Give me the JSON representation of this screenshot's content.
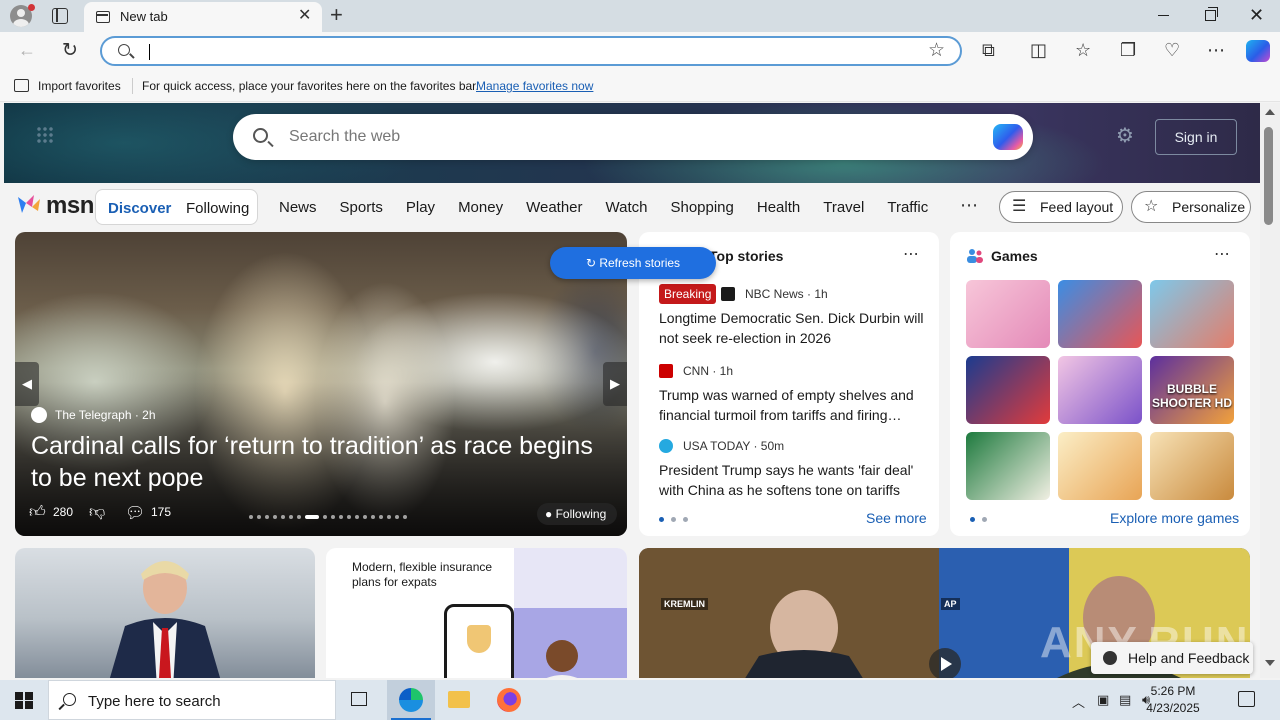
{
  "browser": {
    "tab_title": "New tab",
    "address_value": "",
    "favbar": {
      "import_label": "Import favorites",
      "message": "For quick access, place your favorites here on the favorites bar.",
      "link": "Manage favorites now"
    }
  },
  "msn": {
    "search_placeholder": "Search the web",
    "sign_in": "Sign in",
    "logo": "msn",
    "feed_tabs": {
      "discover": "Discover",
      "following": "Following"
    },
    "nav": [
      "News",
      "Sports",
      "Play",
      "Money",
      "Weather",
      "Watch",
      "Shopping",
      "Health",
      "Travel",
      "Traffic"
    ],
    "feed_layout": "Feed layout",
    "personalize": "Personalize",
    "refresh": "Refresh stories",
    "hero": {
      "source": "The Telegraph",
      "age": "2h",
      "title": "Cardinal calls for ‘return to tradition’ as race begins to be next pope",
      "likes": "280",
      "comments": "175",
      "following": "Following",
      "slide_active": 7,
      "slide_count": 19
    },
    "stories": {
      "title": "Top stories",
      "items": [
        {
          "badge": "Breaking",
          "source": "NBC News · 1h",
          "logo_color": "#1a1a1a",
          "headline": "Longtime Democratic Sen. Dick Durbin will not seek re-election in 2026"
        },
        {
          "source": "CNN · 1h",
          "logo_color": "#cc0000",
          "headline": "Trump was warned of empty shelves and financial turmoil from tariffs and firing…"
        },
        {
          "source": "USA TODAY · 50m",
          "logo_color": "#25a9e0",
          "headline": "President Trump says he wants 'fair deal' with China as he softens tone on tariffs"
        }
      ],
      "see_more": "See more"
    },
    "games": {
      "title": "Games",
      "tiles": [
        {
          "name": "dressup-game",
          "label": "",
          "colors": [
            "#f7c6d9",
            "#e48ab8"
          ]
        },
        {
          "name": "hotel-game",
          "label": "",
          "colors": [
            "#3b8de4",
            "#e85656"
          ]
        },
        {
          "name": "tv-game",
          "label": "",
          "colors": [
            "#7ec8ea",
            "#e37d6a"
          ]
        },
        {
          "name": "block-puzzle-game",
          "label": "",
          "colors": [
            "#1b3b8f",
            "#e23b3b"
          ]
        },
        {
          "name": "makeup-game",
          "label": "",
          "colors": [
            "#f2c6e4",
            "#7b52c9"
          ]
        },
        {
          "name": "bubble-shooter-game",
          "label": "BUBBLE SHOOTER HD",
          "colors": [
            "#5c2f9e",
            "#f2a13b"
          ]
        },
        {
          "name": "mahjong-game",
          "label": "",
          "colors": [
            "#1e7a3e",
            "#f1efe3"
          ]
        },
        {
          "name": "shiba-game",
          "label": "",
          "colors": [
            "#fbeec6",
            "#e8a455"
          ]
        },
        {
          "name": "wood-nuts-game",
          "label": "",
          "colors": [
            "#f7e2b6",
            "#c98a3d"
          ]
        }
      ],
      "more": "Explore more games"
    },
    "ad": {
      "text": "Modern, flexible insurance plans for expats"
    },
    "video_tags": {
      "left": "KREMLIN",
      "right": "AP"
    },
    "watermark": "ANY.RUN",
    "help": "Help and Feedback"
  },
  "taskbar": {
    "search_placeholder": "Type here to search",
    "time": "5:26 PM",
    "date": "4/23/2025"
  }
}
